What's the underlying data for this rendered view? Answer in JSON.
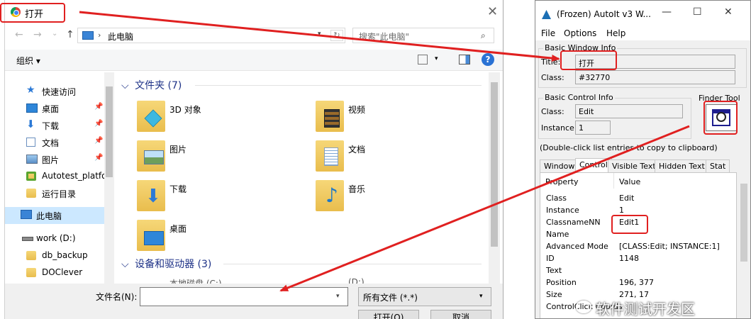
{
  "dialog": {
    "title": "打开",
    "close_glyph": "✕",
    "nav": {
      "back": "←",
      "forward": "→",
      "history": "⌄",
      "up": "↑"
    },
    "address": {
      "separator": "›",
      "text": "此电脑",
      "refresh": "↻"
    },
    "search": {
      "placeholder": "搜索\"此电脑\"",
      "icon": "⌕"
    },
    "toolbar": {
      "organize": "组织 ▾",
      "view_dd": "▾",
      "help": "?"
    },
    "tree": [
      {
        "label": "快速访问",
        "icon": "star-icon",
        "pinned": false
      },
      {
        "label": "桌面",
        "icon": "desktop-icon",
        "pinned": true
      },
      {
        "label": "下载",
        "icon": "download-icon",
        "pinned": true
      },
      {
        "label": "文档",
        "icon": "document-icon",
        "pinned": true
      },
      {
        "label": "图片",
        "icon": "picture-icon",
        "pinned": true
      },
      {
        "label": "Autotest_platfo",
        "icon": "project-icon",
        "pinned": false
      },
      {
        "label": "运行目录",
        "icon": "folder-icon",
        "pinned": false
      },
      {
        "label": "此电脑",
        "icon": "computer-icon",
        "pinned": false
      },
      {
        "label": "work (D:)",
        "icon": "drive-icon",
        "pinned": false
      },
      {
        "label": "db_backup",
        "icon": "folder-icon",
        "pinned": false
      },
      {
        "label": "DOClever",
        "icon": "folder-icon",
        "pinned": false
      }
    ],
    "pin_glyph": "📌",
    "groups": [
      {
        "label": "文件夹 (7)",
        "chevron": "⌵"
      },
      {
        "label": "设备和驱动器 (3)",
        "chevron": "⌵"
      }
    ],
    "folders": [
      {
        "label": "3D 对象",
        "icon": "3d-objects-icon"
      },
      {
        "label": "视频",
        "icon": "video-folder-icon"
      },
      {
        "label": "图片",
        "icon": "pictures-folder-icon"
      },
      {
        "label": "文档",
        "icon": "documents-folder-icon"
      },
      {
        "label": "下载",
        "icon": "downloads-folder-icon"
      },
      {
        "label": "音乐",
        "icon": "music-folder-icon"
      },
      {
        "label": "桌面",
        "icon": "desktop-folder-icon"
      }
    ],
    "drives_partial": [
      "本地磁盘 (C:)",
      "(D:)"
    ],
    "filename": {
      "label": "文件名(N):",
      "value": "",
      "dd": "▾"
    },
    "filetype": {
      "value": "所有文件 (*.*)",
      "dd": "▾"
    },
    "buttons": {
      "open": "打开(O)",
      "cancel": "取消"
    }
  },
  "autoit": {
    "title": "(Frozen) AutoIt v3 W...",
    "controls": {
      "minimize": "—",
      "maximize": "☐",
      "close": "✕"
    },
    "menu": [
      "File",
      "Options",
      "Help"
    ],
    "window_info": {
      "group": "Basic Window Info",
      "title_label": "Title:",
      "title_value": "打开",
      "class_label": "Class:",
      "class_value": "#32770"
    },
    "control_info": {
      "group": "Basic Control Info",
      "class_label": "Class:",
      "class_value": "Edit",
      "instance_label": "Instance:",
      "instance_value": "1"
    },
    "finder_label": "Finder Tool",
    "hint": "(Double-click list entries to copy to clipboard)",
    "tabs": [
      "Window",
      "Control",
      "Visible Text",
      "Hidden Text",
      "Stat"
    ],
    "active_tab": 1,
    "props_header": {
      "property": "Property",
      "value": "Value"
    },
    "props": [
      {
        "k": "Class",
        "v": "Edit"
      },
      {
        "k": "Instance",
        "v": "1"
      },
      {
        "k": "ClassnameNN",
        "v": "Edit1"
      },
      {
        "k": "Name",
        "v": ""
      },
      {
        "k": "Advanced Mode",
        "v": "[CLASS:Edit; INSTANCE:1]"
      },
      {
        "k": "ID",
        "v": "1148"
      },
      {
        "k": "Text",
        "v": ""
      },
      {
        "k": "Position",
        "v": "196, 377"
      },
      {
        "k": "Size",
        "v": "271, 17"
      },
      {
        "k": "ControlClick Coords",
        "v": ""
      }
    ]
  },
  "watermark": "软件测试开发区",
  "colors": {
    "annotation": "#e02020",
    "accent_blue": "#2a72d4"
  }
}
